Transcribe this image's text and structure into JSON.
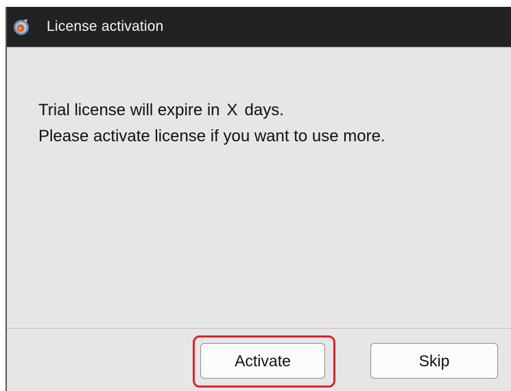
{
  "window": {
    "title": "License activation",
    "app_icon": "app-logo-icon"
  },
  "message": {
    "line1_prefix": "Trial license will expire in",
    "days_value": "X",
    "line1_suffix": "days.",
    "line2": "Please activate license if you want to use more."
  },
  "buttons": {
    "activate_label": "Activate",
    "skip_label": "Skip"
  },
  "colors": {
    "titlebar": "#222222",
    "dialog_background": "#e6e6e6",
    "highlight": "#e0202a"
  }
}
